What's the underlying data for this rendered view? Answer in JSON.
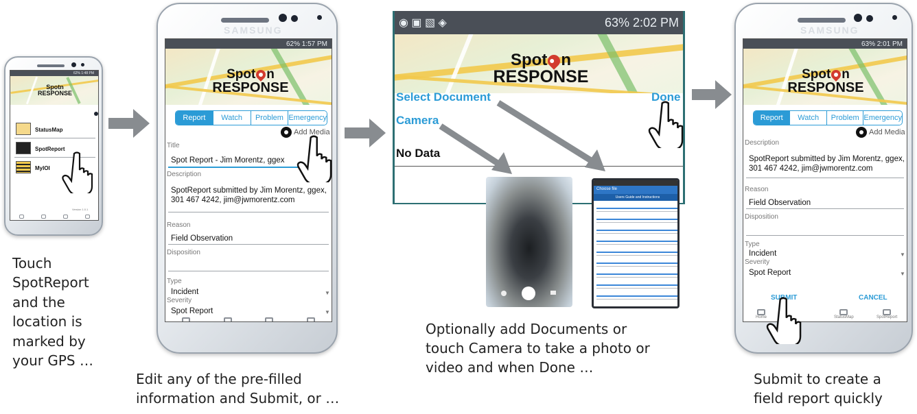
{
  "captions": {
    "step1": [
      "Touch",
      "SpotReport",
      "and the",
      "location is",
      "marked by",
      "your GPS …"
    ],
    "step2": [
      "Edit any of the pre-filled",
      "information and Submit, or …"
    ],
    "step3": [
      "Optionally add Documents or",
      "touch Camera to take a photo or",
      "video and when Done …"
    ],
    "step4": [
      "Submit to create a",
      "field report quickly"
    ]
  },
  "brand": "SAMSUNG",
  "logo": {
    "line1_a": "Spot",
    "line1_b": "n",
    "line2": "RESPONSE"
  },
  "phone1": {
    "status": "62% 1:48 PM",
    "menu": [
      "StatusMap",
      "SpotReport",
      "MyIOI"
    ],
    "version": "Version 1.0.1"
  },
  "phone2": {
    "status": "62% 1:57 PM",
    "tabs": [
      "Report",
      "Watch",
      "Problem",
      "Emergency"
    ],
    "add_media": "Add Media",
    "fields": {
      "title_label": "Title",
      "title_value": "Spot Report - Jim Morentz, ggex",
      "description_label": "Description",
      "description_value": "SpotReport submitted by Jim Morentz, ggex, 301 467 4242, jim@jwmorentz.com",
      "reason_label": "Reason",
      "reason_value": "Field Observation",
      "disposition_label": "Disposition",
      "type_label": "Type",
      "type_value": "Incident",
      "severity_label": "Severity",
      "severity_value": "Spot Report"
    }
  },
  "panel3": {
    "status": "63% 2:02 PM",
    "select_document": "Select Document",
    "done": "Done",
    "camera": "Camera",
    "no_data": "No Data",
    "file_chooser_title": "Choose file",
    "file_chooser_header": "Users Guide and Instructions"
  },
  "phone4": {
    "status": "63% 2:01 PM",
    "tabs": [
      "Report",
      "Watch",
      "Problem",
      "Emergency"
    ],
    "add_media": "Add Media",
    "fields": {
      "description_label": "Description",
      "description_value": "SpotReport submitted by Jim Morentz, ggex, 301 467 4242, jim@jwmorentz.com",
      "reason_label": "Reason",
      "reason_value": "Field Observation",
      "disposition_label": "Disposition",
      "type_label": "Type",
      "type_value": "Incident",
      "severity_label": "Severity",
      "severity_value": "Spot Report"
    },
    "submit": "SUBMIT",
    "cancel": "CANCEL",
    "nav": [
      "Home",
      "StatusMap",
      "SpotReport"
    ]
  },
  "colors": {
    "accent": "#2b9bd6",
    "arrow": "#888c90",
    "pin": "#d23b2e"
  }
}
